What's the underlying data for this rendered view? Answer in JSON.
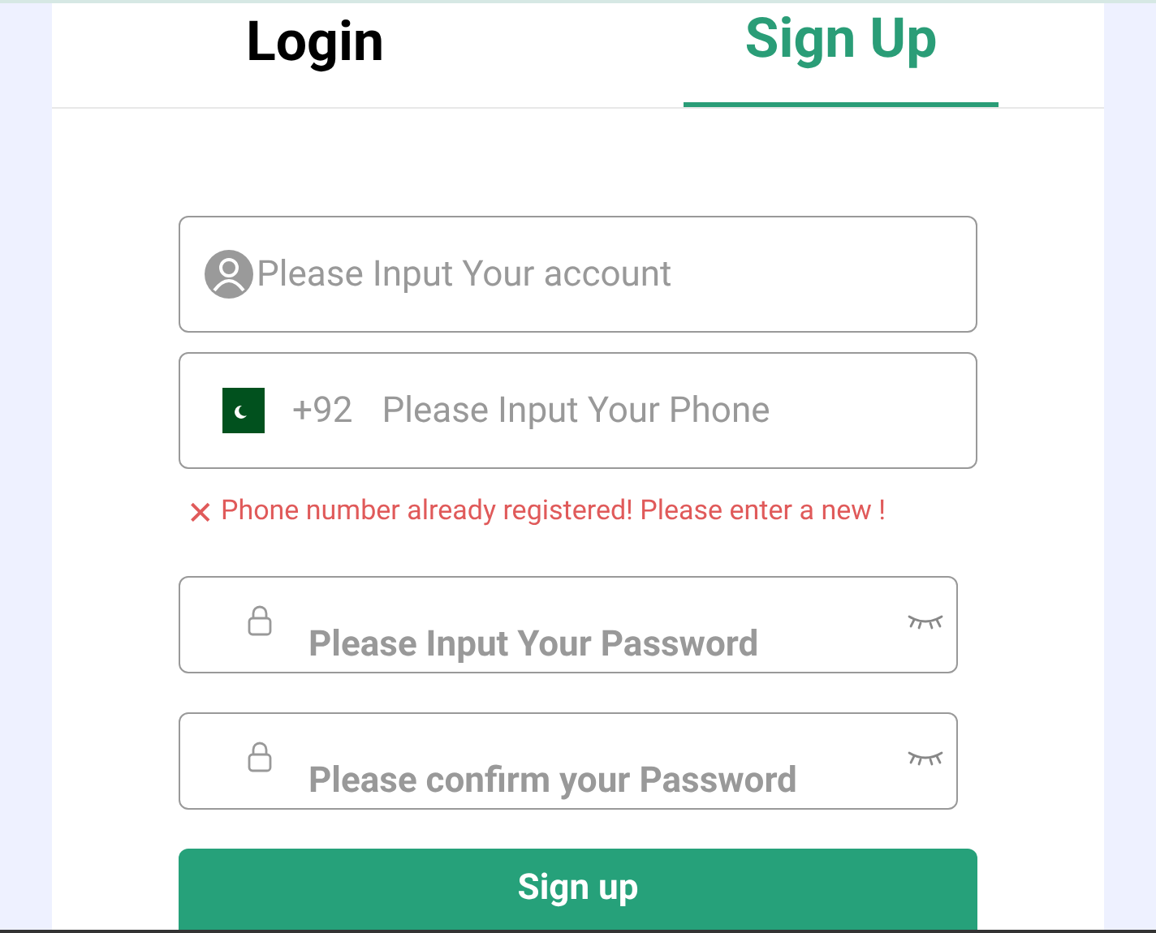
{
  "tabs": [
    {
      "label": "Login",
      "selected": false
    },
    {
      "label": "Sign Up",
      "selected": true
    }
  ],
  "account": {
    "placeholder": "Please Input Your account"
  },
  "phone": {
    "country_code": "+92",
    "placeholder": "Please Input Your Phone"
  },
  "error": {
    "icon": "✕",
    "text": "Phone number already registered! Please enter a new !"
  },
  "passwords": [
    {
      "placeholder": "Please Input Your Password"
    },
    {
      "placeholder": "Please confirm your Password"
    }
  ],
  "submit": "Sign up"
}
